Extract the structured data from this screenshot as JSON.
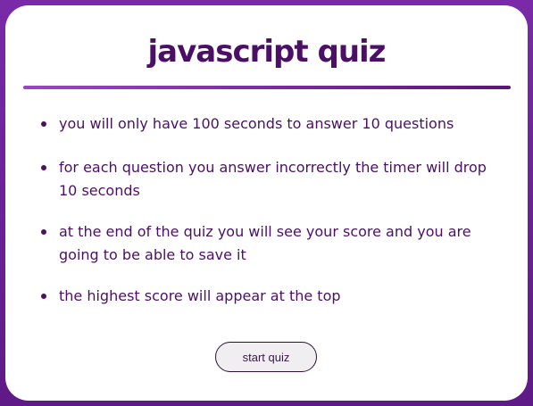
{
  "quiz": {
    "title": "javascript quiz",
    "rules": [
      "you will only have 100 seconds to answer 10 questions",
      "for each question you answer incorrectly the timer will drop 10 seconds",
      "at the end of the quiz you will see your score and you are going to be able to save it",
      "the highest score will appear at the top"
    ],
    "start_label": "start quiz"
  },
  "colors": {
    "accent": "#4b1066",
    "background": "#6a1f96",
    "card": "#ffffff"
  }
}
